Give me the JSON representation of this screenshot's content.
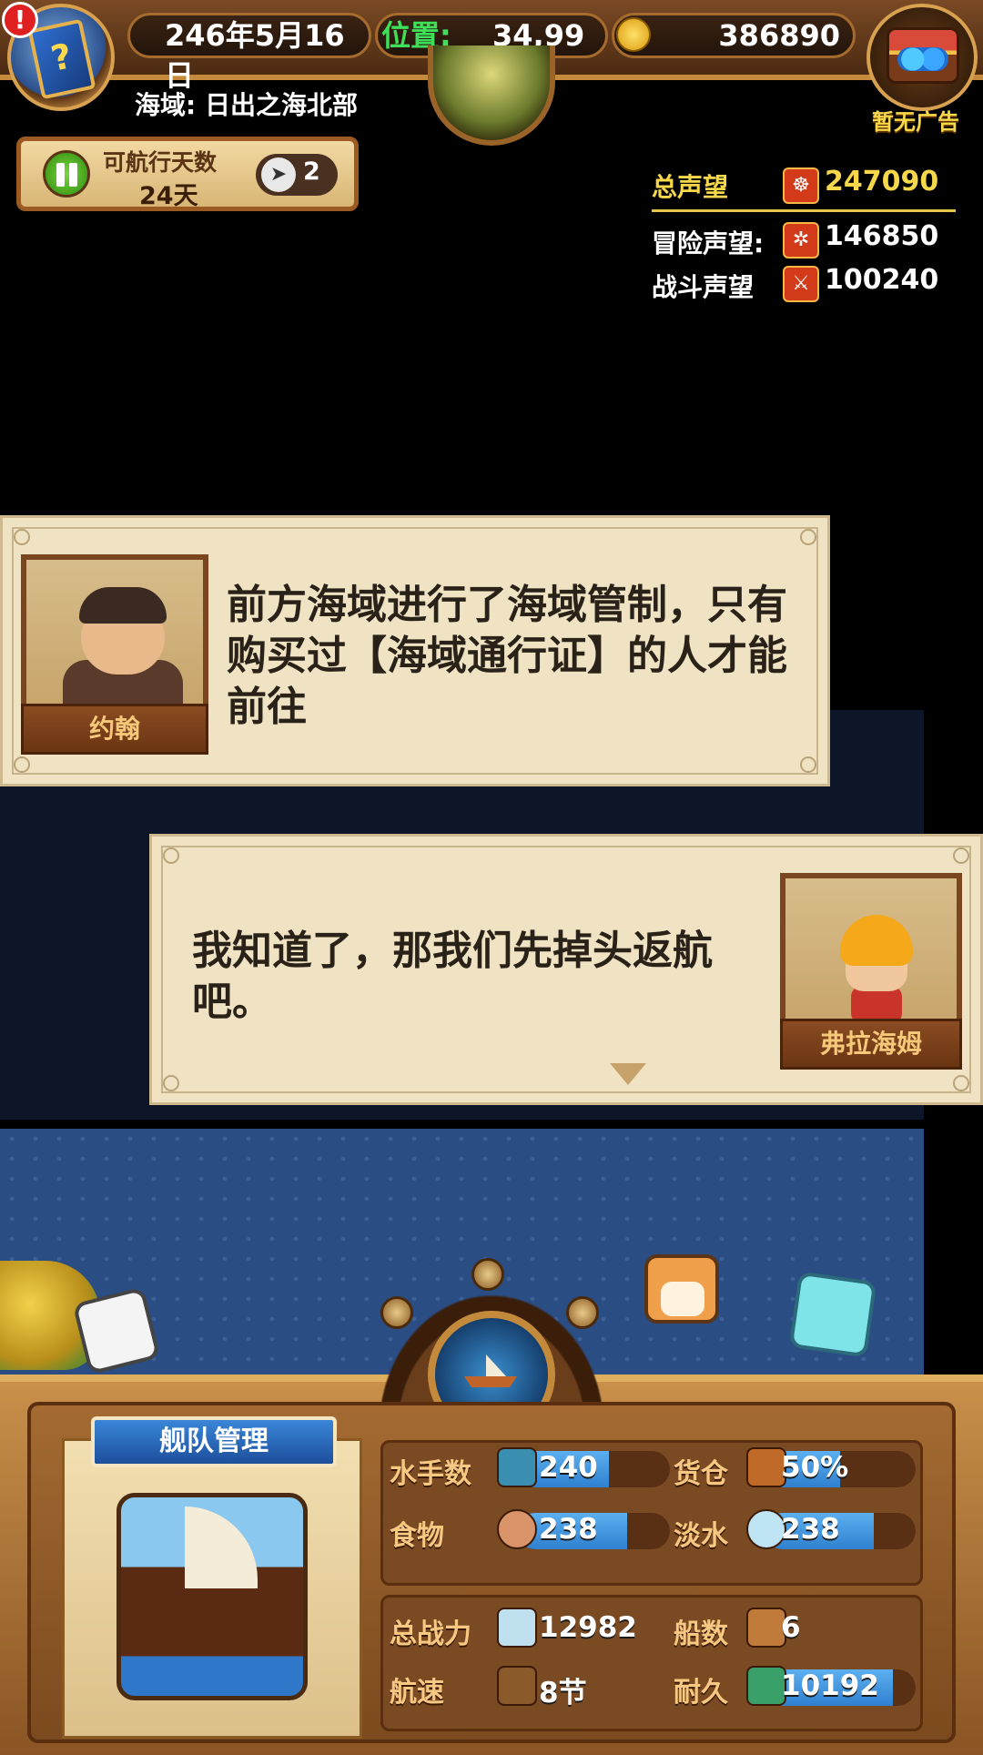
{
  "hud": {
    "date": "246年5月16日",
    "position_label": "位置:",
    "position_value": "34,99",
    "gold": "386890",
    "region": "海域: 日出之海北部",
    "ad_label": "暂无广告",
    "alert": "!"
  },
  "sailing": {
    "label": "可航行天数",
    "days": "24天",
    "speed_multiplier": "2"
  },
  "reputation": {
    "total_label": "总声望",
    "total_value": "247090",
    "adventure_label": "冒险声望:",
    "adventure_value": "146850",
    "battle_label": "战斗声望",
    "battle_value": "100240"
  },
  "dialogs": [
    {
      "speaker": "约翰",
      "text": "前方海域进行了海域管制，只有购买过【海域通行证】的人才能前往"
    },
    {
      "speaker": "弗拉海姆",
      "text": "我知道了，那我们先掉头返航吧。"
    }
  ],
  "fleet": {
    "title": "舰队管理",
    "stats": {
      "sailors_label": "水手数",
      "sailors_value": "240",
      "cargo_label": "货仓",
      "cargo_value": "50%",
      "food_label": "食物",
      "food_value": "238",
      "water_label": "淡水",
      "water_value": "238",
      "power_label": "总战力",
      "power_value": "12982",
      "ships_label": "船数",
      "ships_value": "6",
      "speed_label": "航速",
      "speed_value": "8节",
      "durability_label": "耐久",
      "durability_value": "10192"
    },
    "bar_levels": {
      "sailors": 0.6,
      "cargo": 0.5,
      "food": 0.72,
      "water": 0.72,
      "durability": 0.85
    }
  },
  "colors": {
    "accent_gold": "#f6d84a",
    "green_highlight": "#3ee05a",
    "bar_blue": "#3a8fd8",
    "wood": "#8a5424"
  }
}
